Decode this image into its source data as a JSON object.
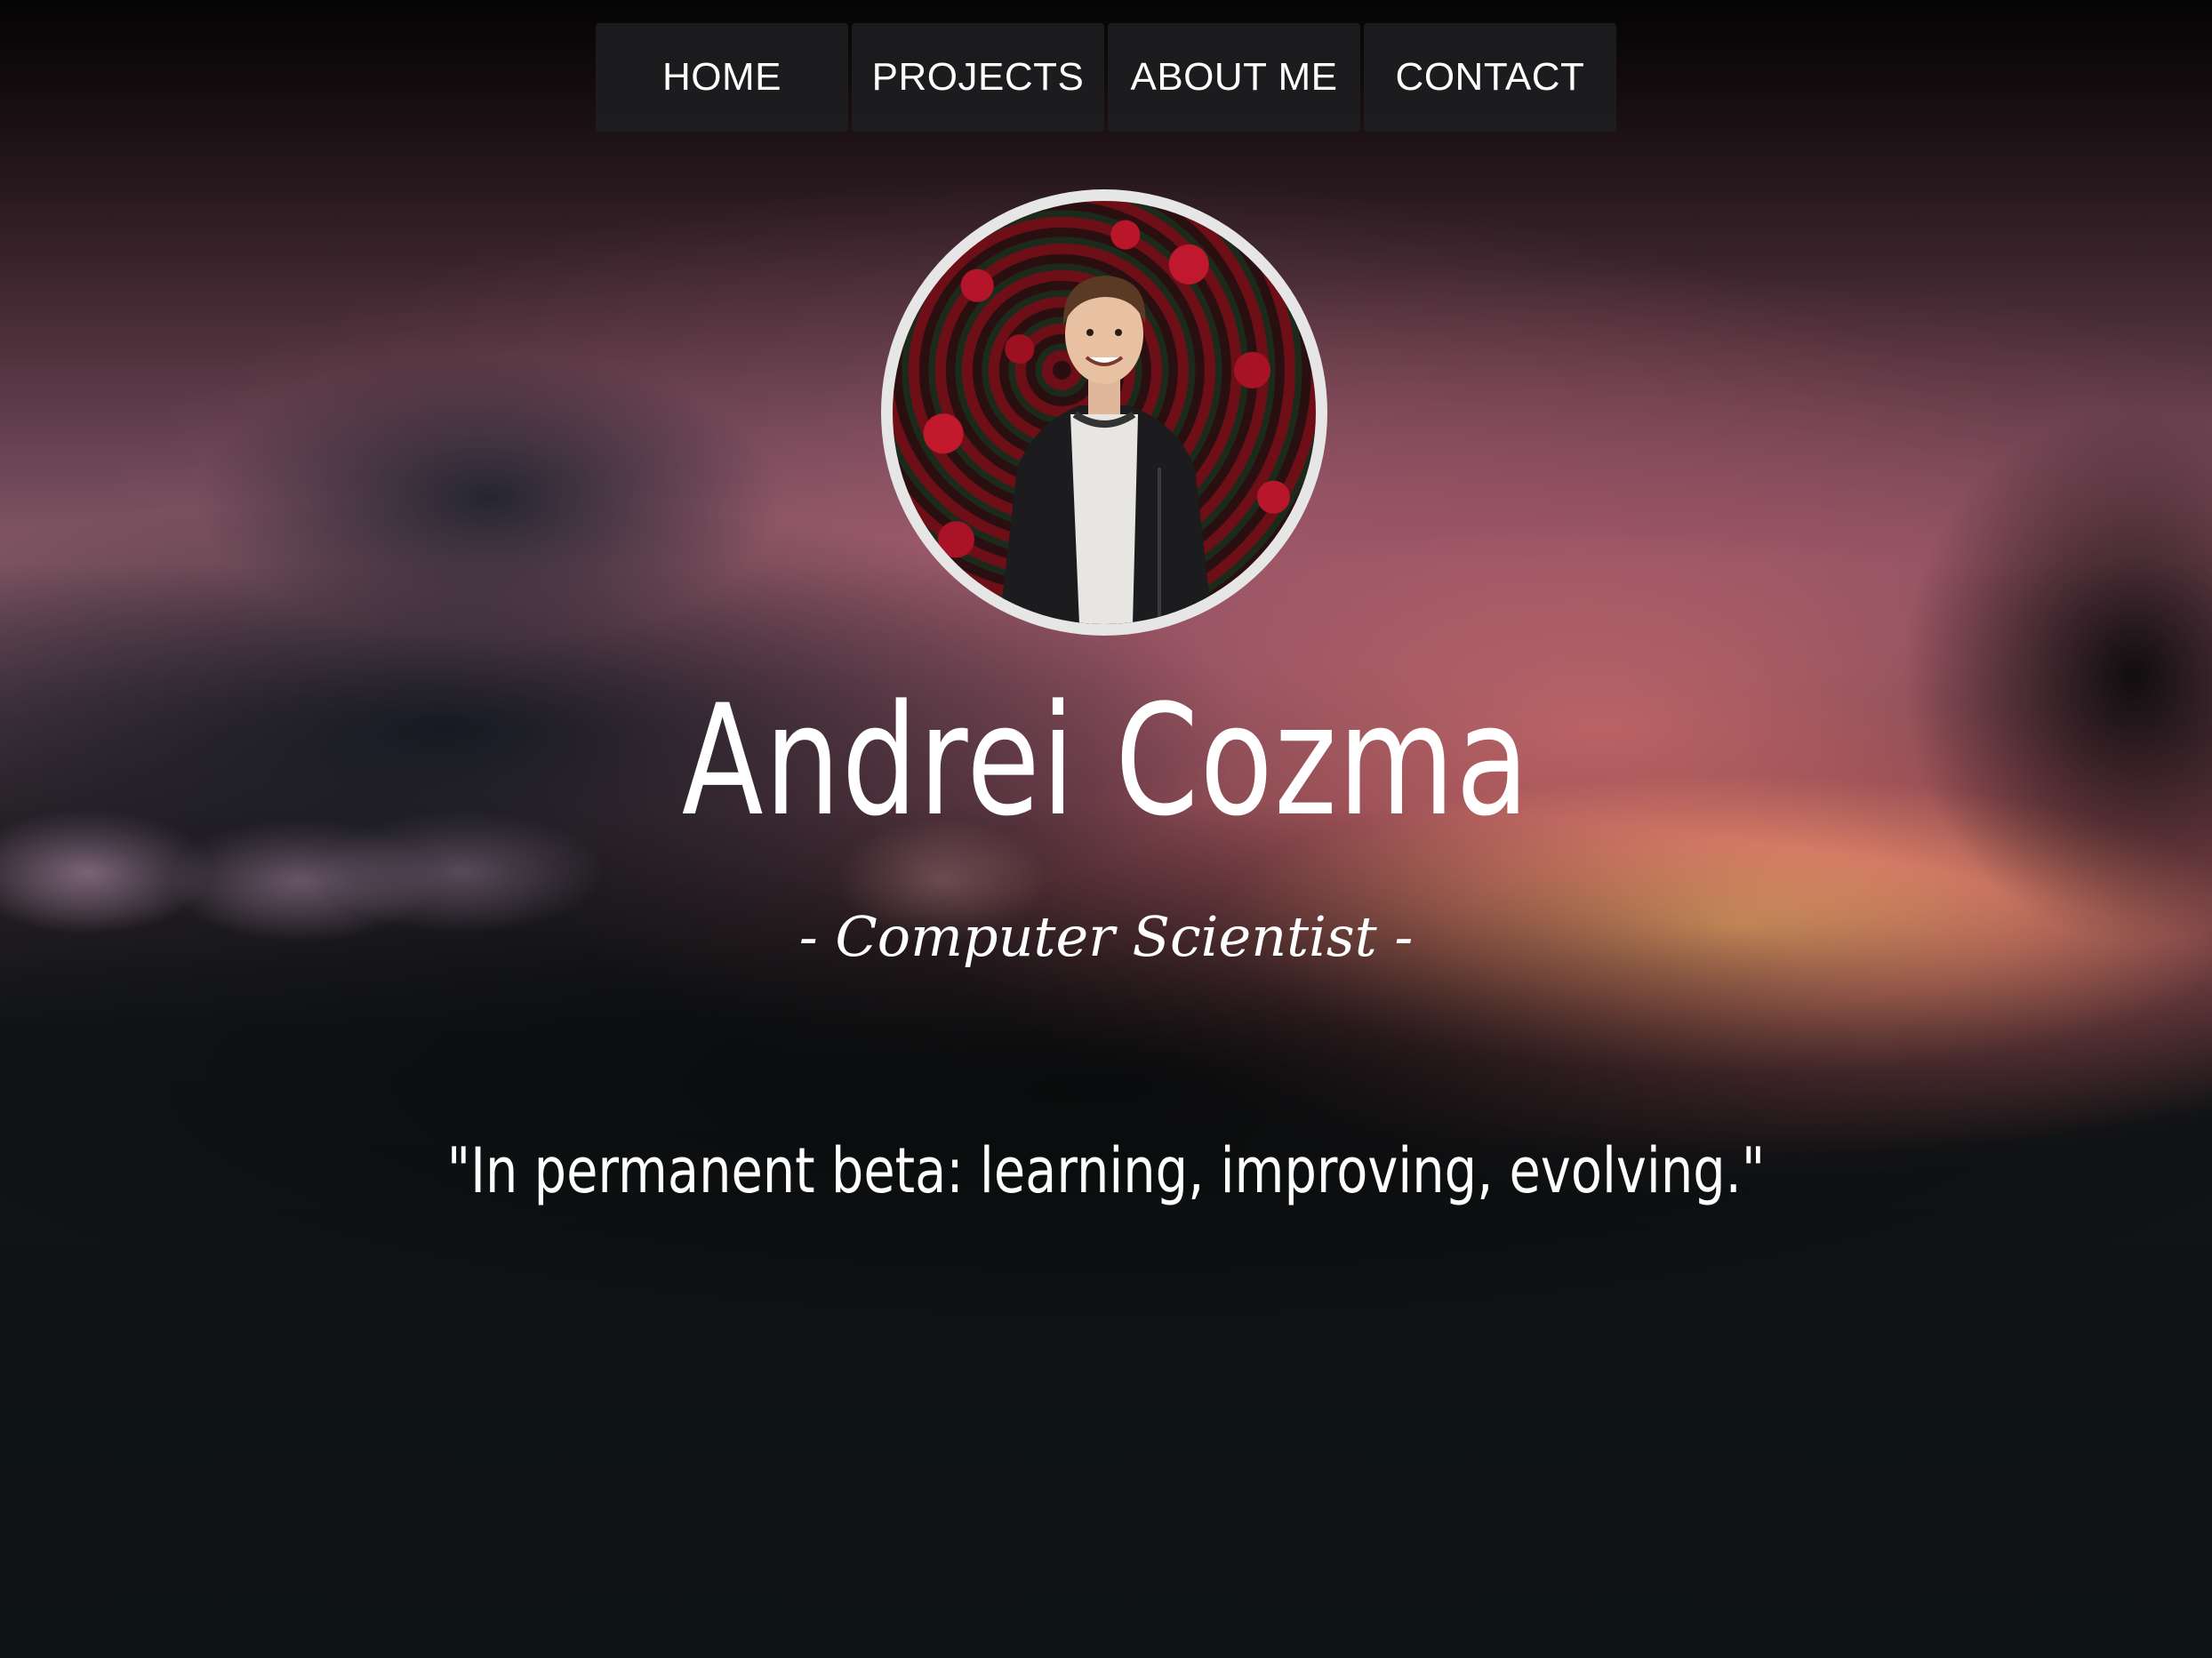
{
  "nav": {
    "items": [
      {
        "label": "HOME"
      },
      {
        "label": "PROJECTS"
      },
      {
        "label": "ABOUT ME"
      },
      {
        "label": "CONTACT"
      }
    ]
  },
  "hero": {
    "name": "Andrei Cozma",
    "subtitle": "- Computer Scientist -",
    "quote": "\"In permanent beta: learning, improving, evolving.\""
  },
  "colors": {
    "text": "#ffffff",
    "nav_bg": "#1e1e20",
    "avatar_ring": "#e6e6e6",
    "sunset_glow": "#ffb06e"
  }
}
